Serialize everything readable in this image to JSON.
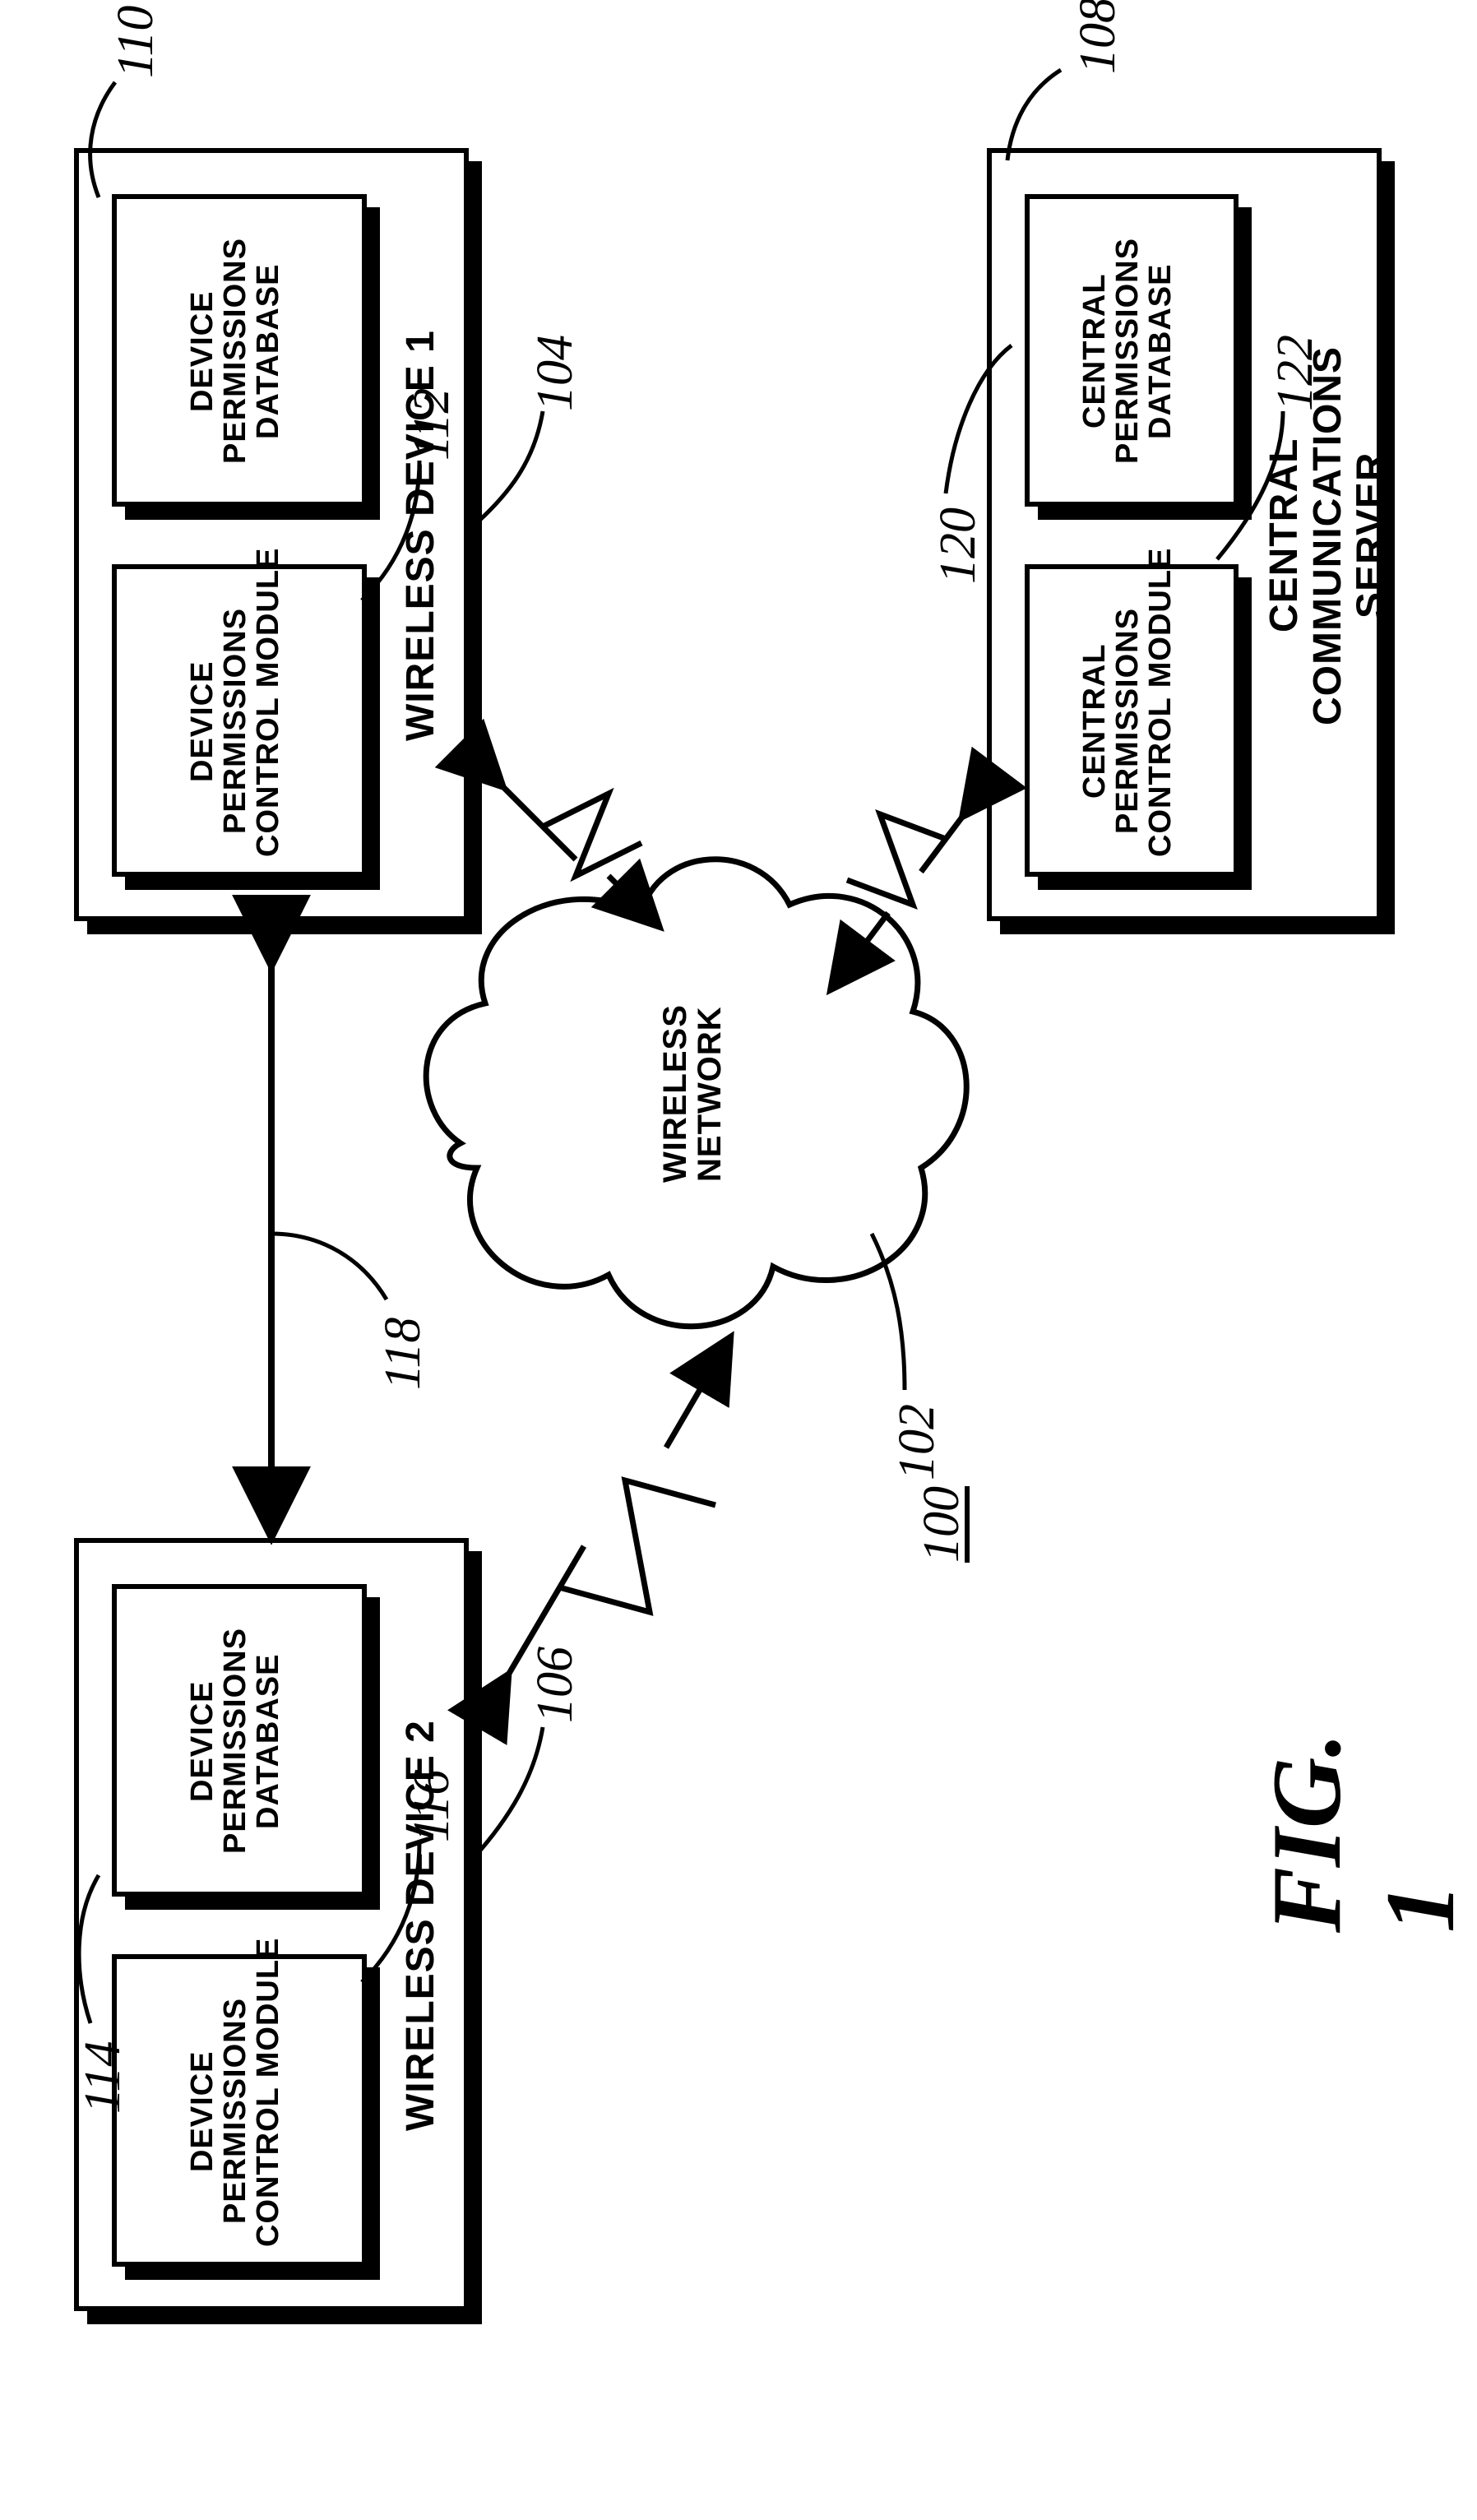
{
  "figure": {
    "caption": "FIG. 1",
    "system_ref": "100"
  },
  "refs": {
    "network": "102",
    "device1": "104",
    "device2": "106",
    "server": "108",
    "d1_db": "110",
    "d1_mod": "112",
    "d2_db": "114",
    "d2_mod": "116",
    "direct_link": "118",
    "s_db": "120",
    "s_mod": "122"
  },
  "network": {
    "label": "WIRELESS\nNETWORK"
  },
  "device1": {
    "title": "WIRELESS DEVICE 1",
    "db": "DEVICE\nPERMISSIONS\nDATABASE",
    "mod": "DEVICE\nPERMISSIONS\nCONTROL MODULE"
  },
  "device2": {
    "title": "WIRELESS DEVICE 2",
    "db": "DEVICE\nPERMISSIONS\nDATABASE",
    "mod": "DEVICE\nPERMISSIONS\nCONTROL MODULE"
  },
  "server": {
    "title": "CENTRAL\nCOMMUNICATIONS\nSERVER",
    "db": "CENTRAL\nPERMISSIONS\nDATABASE",
    "mod": "CENTRAL\nPERMISSIONS\nCONTROL MODULE"
  }
}
